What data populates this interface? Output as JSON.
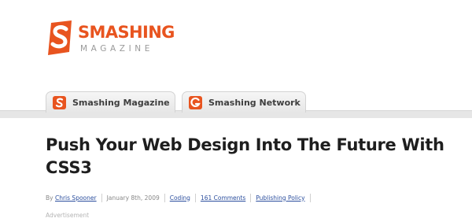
{
  "logo": {
    "title": "SMASHING",
    "subtitle": "MAGAZINE"
  },
  "tabs": [
    {
      "label": "Smashing Magazine",
      "icon": "smashing-s-icon"
    },
    {
      "label": "Smashing Network",
      "icon": "smashing-network-icon"
    }
  ],
  "article": {
    "title": "Push Your Web Design Into The Future With CSS3",
    "meta": {
      "by_prefix": "By",
      "author": "Chris Spooner",
      "date": "January 8th, 2009",
      "category": "Coding",
      "comments": "161 Comments",
      "policy": "Publishing Policy"
    },
    "advertisement_label": "Advertisement"
  },
  "colors": {
    "brand_orange": "#e8541f",
    "link_blue": "#2c4f9e"
  }
}
